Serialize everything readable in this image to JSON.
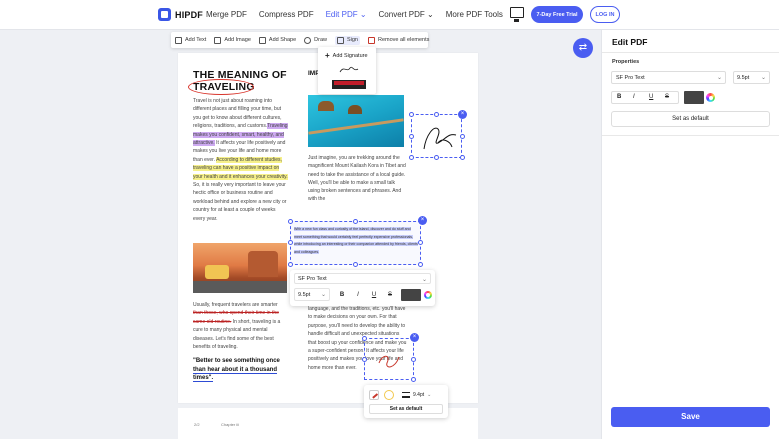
{
  "brand": {
    "name": "HIPDF"
  },
  "nav": {
    "items": [
      "Merge PDF",
      "Compress PDF",
      "Edit PDF ⌄",
      "Convert PDF ⌄",
      "More PDF Tools"
    ],
    "active_index": 2,
    "trial": "7-Day Free Trial",
    "login": "LOG IN"
  },
  "toolbar": {
    "add_text": "Add Text",
    "add_image": "Add Image",
    "add_shape": "Add Shape",
    "draw": "Draw",
    "sign": "Sign",
    "remove_all": "Remove all elements"
  },
  "sign_menu": {
    "add_signature": "Add Signature"
  },
  "doc": {
    "title_line1": "THE MEANING OF",
    "title_line2": "TRAVELING",
    "p1_a": "Travel is not just about roaming into different places and filling your time, but you get to know about different cultures, religions, traditions, and customs.",
    "p1_hl": "Traveling makes you confident, smart, healthy, and attractive.",
    "p1_b": " It affects your life positively and makes you live your life and home more than ever.",
    "p1_hl2": "According to different studies, traveling can have a positive impact on your health and it enhances your creativity.",
    "p1_c": " So, it is really very important to leave your hectic office or business routine and workload behind and explore a new city or country for at least a couple of weeks every year.",
    "p2_a": "Usually, frequent travelers are smarter ",
    "p2_strike": "than those, who spend their time in the same old routine.",
    "p2_b": " In short, traveling is a cure to many physical and mental diseases. Let's find some of the best benefits of traveling.",
    "quote_a": "\"Better to see something once ",
    "quote_b": "than hear about it a thousand times\".",
    "right_head": "IMPO... CO... ...S",
    "right_p1": "Just imagine, you are trekking around the magnificent Mount Kailash Kora in Tibet and need to take the assistance of a local guide. Well, you'll be able to make a small talk using broken sentences and phrases. And with the",
    "sel_text": "With a new fun class and curiosity of the island, discover and do stuff and meet something that would certainly feel perfectly expensive professionals, while introducing an interesting or their companion attended by friends, clients and colleagues.",
    "right_p2": "language, and the traditions, etc. you'll have to make decisions on your own. For that purpose, you'll need to develop the ability to handle difficult and unexpected situations that boost up your confidence and make you a super-confident person. It affects your life positively and makes you love your life and home more than ever.",
    "page2_num": "2/2",
    "page2_chapter": "Chapter iii"
  },
  "font_popup": {
    "font": "SF Pro Text",
    "size": "9.5pt",
    "bold": "B",
    "italic": "I",
    "underline": "U",
    "strike": "S"
  },
  "line_popup": {
    "weight": "9.4pt",
    "default": "Set as default"
  },
  "panel": {
    "title": "Edit PDF",
    "properties": "Properties",
    "font": "SF Pro Text",
    "size": "9.5pt",
    "bold": "B",
    "italic": "I",
    "underline": "U",
    "strike": "S",
    "set_default": "Set as default",
    "save": "Save"
  },
  "colors": {
    "accent": "#4a5df1",
    "text_color": "#444444"
  }
}
